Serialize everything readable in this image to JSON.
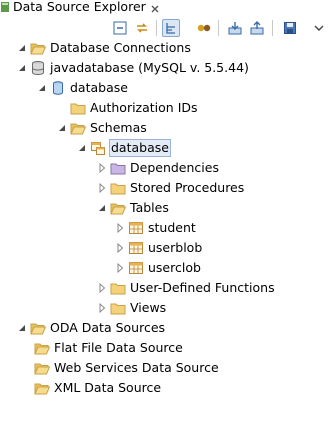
{
  "view": {
    "title": "Data Source Explorer",
    "icons": {
      "view": "data-source-explorer-icon",
      "close": "close-icon"
    }
  },
  "toolbar": {
    "buttons": [
      {
        "name": "collapse-all-button",
        "icon": "collapse-all-icon"
      },
      {
        "name": "link-with-editor-button",
        "icon": "link-icon"
      },
      {
        "name": "toggle-view-button",
        "icon": "tree-view-icon",
        "active": true
      },
      {
        "name": "connect-button",
        "icon": "connect-icon"
      },
      {
        "name": "import-button",
        "icon": "import-icon"
      },
      {
        "name": "export-button",
        "icon": "export-icon"
      },
      {
        "name": "save-button",
        "icon": "save-icon"
      },
      {
        "name": "view-menu-button",
        "icon": "chevron-down-icon"
      }
    ]
  },
  "tree": {
    "database_connections": "Database Connections",
    "javadatabase": "javadatabase (MySQL v. 5.5.44)",
    "database": "database",
    "authorization_ids": "Authorization IDs",
    "schemas": "Schemas",
    "schema_database": "database",
    "dependencies": "Dependencies",
    "stored_procedures": "Stored Procedures",
    "tables": "Tables",
    "table_student": "student",
    "table_userblob": "userblob",
    "table_userclob": "userclob",
    "user_defined_functions": "User-Defined Functions",
    "views": "Views",
    "oda_data_sources": "ODA Data Sources",
    "flat_file": "Flat File Data Source",
    "web_services": "Web Services Data Source",
    "xml": "XML Data Source"
  },
  "colors": {
    "folder": "#f3d27a",
    "folder_border": "#c9a24a",
    "selection_bg": "#e3ebf7",
    "selection_border": "#9ab4d6"
  }
}
